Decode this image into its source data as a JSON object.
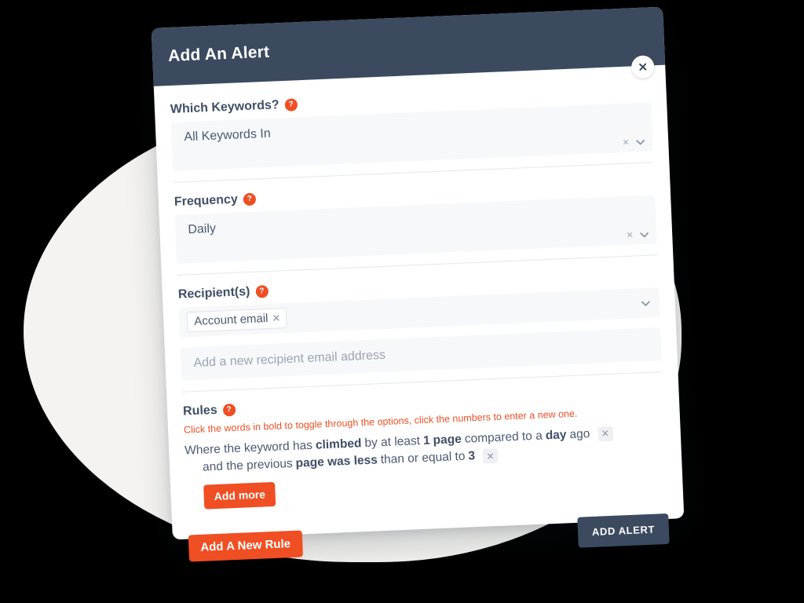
{
  "dialog": {
    "title": "Add An Alert",
    "close_icon": "close-icon",
    "close_glyph": "✕"
  },
  "fields": {
    "keywords": {
      "label": "Which Keywords?",
      "help_glyph": "?",
      "value": "All Keywords In",
      "clear_glyph": "×",
      "chevron_glyph": "⌄"
    },
    "frequency": {
      "label": "Frequency",
      "help_glyph": "?",
      "value": "Daily",
      "clear_glyph": "×",
      "chevron_glyph": "⌄"
    },
    "recipients": {
      "label": "Recipient(s)",
      "help_glyph": "?",
      "chip_label": "Account email",
      "chip_remove_glyph": "✕",
      "chevron_glyph": "⌄",
      "new_recipient_placeholder": "Add a new recipient email address",
      "new_recipient_value": ""
    }
  },
  "rules": {
    "label": "Rules",
    "help_glyph": "?",
    "hint": "Click the words in bold to toggle through the options, click the numbers to enter a new one.",
    "line1": {
      "t1": "Where the keyword has",
      "condition": "climbed",
      "t2": "by at least",
      "amount": "1",
      "unit": "page",
      "t3": "compared to a",
      "period": "day",
      "t4": "ago",
      "delete_glyph": "✕"
    },
    "line2": {
      "t1": "and the previous",
      "comparator": "page was less",
      "t2": "than or equal to",
      "value": "3",
      "delete_glyph": "✕"
    },
    "add_more_label": "Add more",
    "add_new_rule_label": "Add A New Rule"
  },
  "footer": {
    "submit_label": "ADD ALERT"
  },
  "colors": {
    "header_navy": "#3b4a5f",
    "accent_orange": "#f04e23",
    "field_bg": "#f7f8fa",
    "text_slate": "#4a5a70",
    "blob_gray": "#f4f3f1"
  }
}
